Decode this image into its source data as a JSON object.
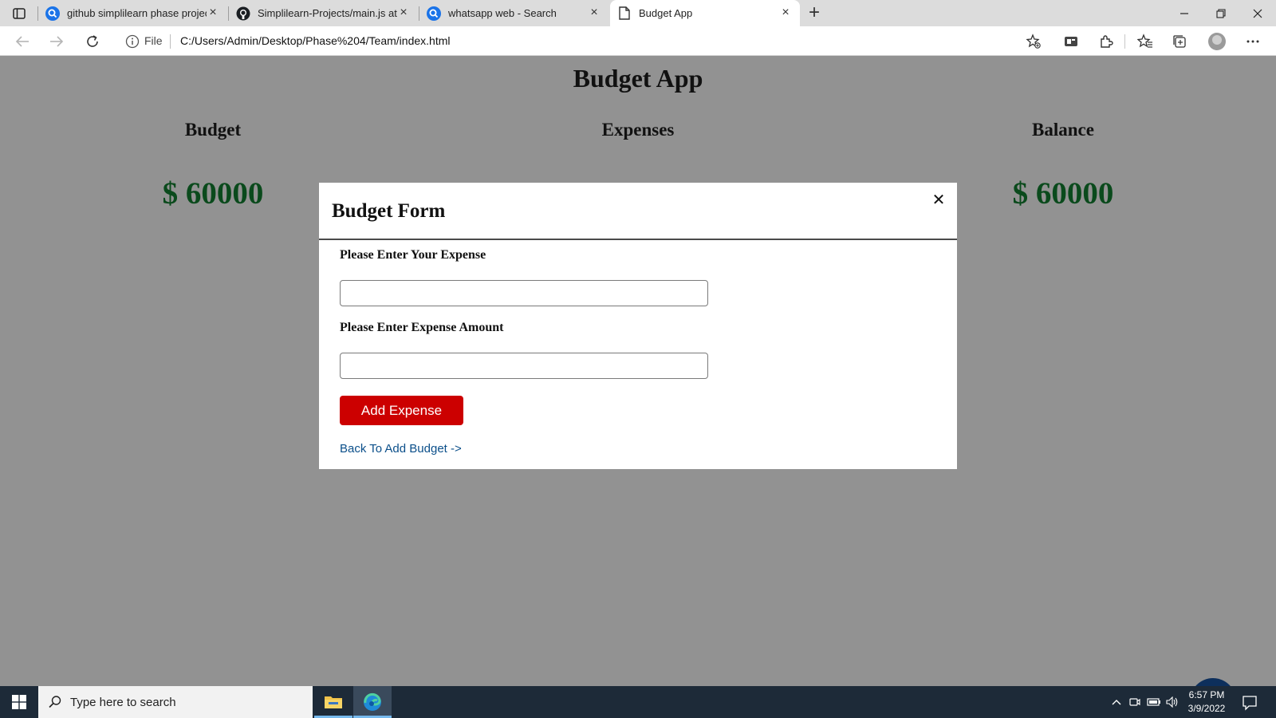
{
  "browser": {
    "tabs": [
      {
        "label": "github simplilearn phase project",
        "icon": "search-icon",
        "active": false
      },
      {
        "label": "Simplilearn-Projects/main.js at m",
        "icon": "github-icon",
        "active": false
      },
      {
        "label": "whatsapp web - Search",
        "icon": "search-icon",
        "active": false
      },
      {
        "label": "Budget App",
        "icon": "page-icon",
        "active": true
      }
    ],
    "address": {
      "scheme_label": "File",
      "url": "C:/Users/Admin/Desktop/Phase%204/Team/index.html"
    }
  },
  "app": {
    "title": "Budget App",
    "columns": {
      "budget": {
        "label": "Budget",
        "amount": "$ 60000"
      },
      "expenses": {
        "label": "Expenses"
      },
      "balance": {
        "label": "Balance",
        "amount": "$ 60000"
      }
    },
    "modal": {
      "title": "Budget Form",
      "close_glyph": "✕",
      "expense_label": "Please Enter Your Expense",
      "expense_value": "",
      "amount_label": "Please Enter Expense Amount",
      "amount_value": "",
      "submit_label": "Add Expense",
      "back_link": "Back To Add Budget ->"
    },
    "fab_glyph": "+"
  },
  "taskbar": {
    "search_placeholder": "Type here to search",
    "time": "6:57 PM",
    "date": "3/9/2022"
  },
  "colors": {
    "amount_green": "#0a4a1c",
    "button_red": "#cc0000",
    "fab_navy": "#0d2f5c",
    "overlay_gray": "#929292"
  }
}
